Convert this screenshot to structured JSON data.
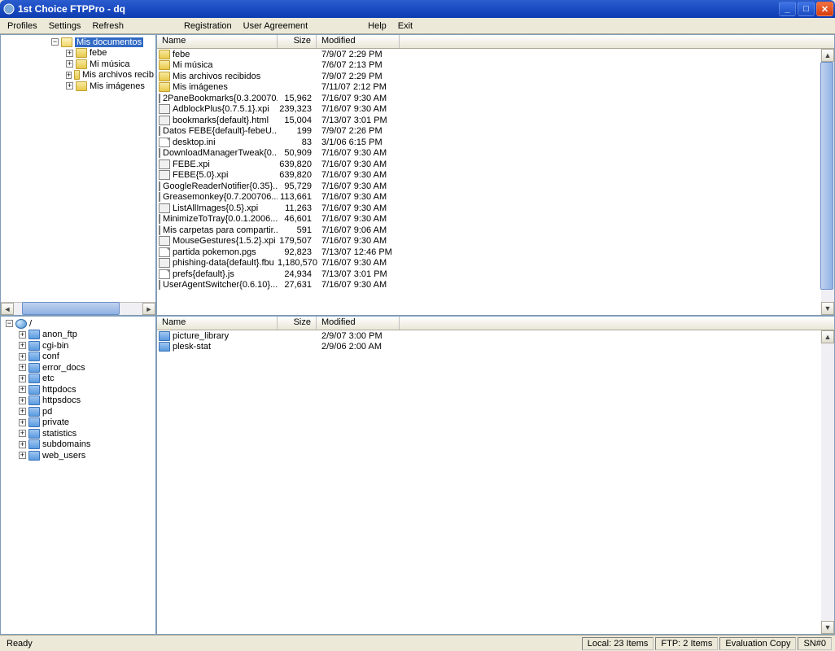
{
  "window": {
    "title": "1st Choice FTPPro - dq"
  },
  "menu": {
    "profiles": "Profiles",
    "settings": "Settings",
    "refresh": "Refresh",
    "registration": "Registration",
    "user_agreement": "User Agreement",
    "help": "Help",
    "exit": "Exit"
  },
  "cols": {
    "name": "Name",
    "size": "Size",
    "modified": "Modified"
  },
  "local_tree": {
    "root": "Mis documentos",
    "items": [
      "febe",
      "Mi música",
      "Mis archivos recibidos",
      "Mis imágenes"
    ]
  },
  "local_files": [
    {
      "icon": "folder",
      "name": "febe",
      "size": "",
      "mod": "7/9/07 2:29 PM"
    },
    {
      "icon": "folder",
      "name": "Mi música",
      "size": "",
      "mod": "7/6/07 2:13 PM"
    },
    {
      "icon": "folder",
      "name": "Mis archivos recibidos",
      "size": "",
      "mod": "7/9/07 2:29 PM"
    },
    {
      "icon": "folder",
      "name": "Mis imágenes",
      "size": "",
      "mod": "7/11/07 2:12 PM"
    },
    {
      "icon": "xpi",
      "name": "2PaneBookmarks{0.3.20070...",
      "size": "15,962",
      "mod": "7/16/07 9:30 AM"
    },
    {
      "icon": "xpi",
      "name": "AdblockPlus{0.7.5.1}.xpi",
      "size": "239,323",
      "mod": "7/16/07 9:30 AM"
    },
    {
      "icon": "xpi",
      "name": "bookmarks{default}.html",
      "size": "15,004",
      "mod": "7/13/07 3:01 PM"
    },
    {
      "icon": "xpi",
      "name": "Datos FEBE{default}-febeU...",
      "size": "199",
      "mod": "7/9/07 2:26 PM"
    },
    {
      "icon": "file",
      "name": "desktop.ini",
      "size": "83",
      "mod": "3/1/06 6:15 PM"
    },
    {
      "icon": "xpi",
      "name": "DownloadManagerTweak{0...",
      "size": "50,909",
      "mod": "7/16/07 9:30 AM"
    },
    {
      "icon": "xpi",
      "name": "FEBE.xpi",
      "size": "639,820",
      "mod": "7/16/07 9:30 AM"
    },
    {
      "icon": "xpi",
      "name": "FEBE{5.0}.xpi",
      "size": "639,820",
      "mod": "7/16/07 9:30 AM"
    },
    {
      "icon": "xpi",
      "name": "GoogleReaderNotifier{0.35}...",
      "size": "95,729",
      "mod": "7/16/07 9:30 AM"
    },
    {
      "icon": "xpi",
      "name": "Greasemonkey{0.7.200706...",
      "size": "113,661",
      "mod": "7/16/07 9:30 AM"
    },
    {
      "icon": "xpi",
      "name": "ListAllImages{0.5}.xpi",
      "size": "11,263",
      "mod": "7/16/07 9:30 AM"
    },
    {
      "icon": "xpi",
      "name": "MinimizeToTray{0.0.1.2006...",
      "size": "46,601",
      "mod": "7/16/07 9:30 AM"
    },
    {
      "icon": "xpi",
      "name": "Mis carpetas para compartir...",
      "size": "591",
      "mod": "7/16/07 9:06 AM"
    },
    {
      "icon": "xpi",
      "name": "MouseGestures{1.5.2}.xpi",
      "size": "179,507",
      "mod": "7/16/07 9:30 AM"
    },
    {
      "icon": "file",
      "name": "partida pokemon.pgs",
      "size": "92,823",
      "mod": "7/13/07 12:46 PM"
    },
    {
      "icon": "xpi",
      "name": "phishing-data{default}.fbu",
      "size": "1,180,570",
      "mod": "7/16/07 9:30 AM"
    },
    {
      "icon": "file",
      "name": "prefs{default}.js",
      "size": "24,934",
      "mod": "7/13/07 3:01 PM"
    },
    {
      "icon": "xpi",
      "name": "UserAgentSwitcher{0.6.10}...",
      "size": "27,631",
      "mod": "7/16/07 9:30 AM"
    }
  ],
  "remote_tree": {
    "root": "/",
    "items": [
      "anon_ftp",
      "cgi-bin",
      "conf",
      "error_docs",
      "etc",
      "httpdocs",
      "httpsdocs",
      "pd",
      "private",
      "statistics",
      "subdomains",
      "web_users"
    ]
  },
  "remote_files": [
    {
      "icon": "folderb",
      "name": "picture_library",
      "size": "",
      "mod": "2/9/07 3:00 PM"
    },
    {
      "icon": "folderb",
      "name": "plesk-stat",
      "size": "",
      "mod": "2/9/06 2:00 AM"
    }
  ],
  "status": {
    "ready": "Ready",
    "local": "Local: 23 Items",
    "ftp": "FTP: 2 Items",
    "eval": "Evaluation Copy",
    "sn": "SN#0"
  }
}
